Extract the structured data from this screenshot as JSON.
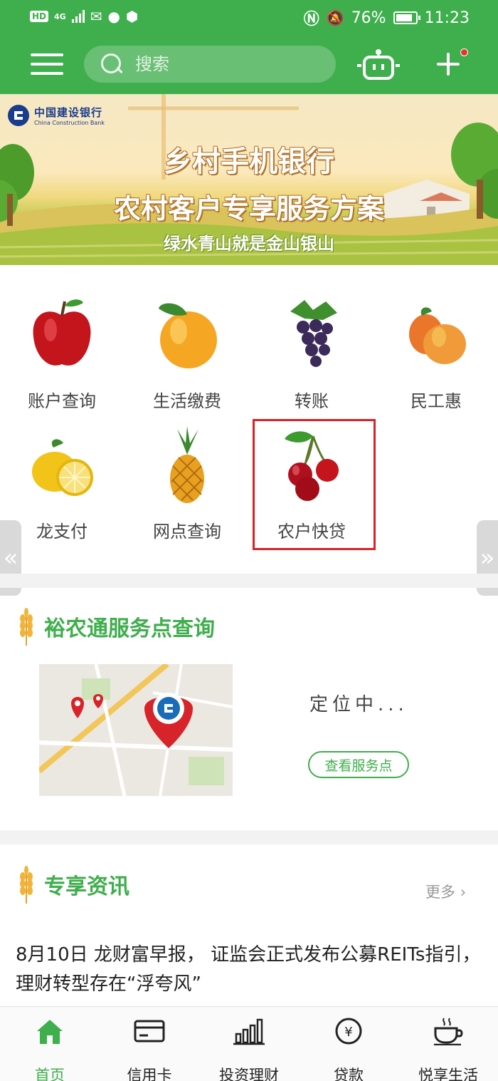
{
  "status_bar": {
    "hd": "HD",
    "network": "4G",
    "battery": "76%",
    "time": "11:23"
  },
  "header": {
    "search_placeholder": "搜索"
  },
  "banner": {
    "bank_name_cn": "中国建设银行",
    "bank_name_en": "China Construction Bank",
    "title": "乡村手机银行",
    "subtitle": "农村客户专享服务方案",
    "slogan": "绿水青山就是金山银山"
  },
  "grid": {
    "items": [
      {
        "label": "账户查询",
        "icon": "apple-icon"
      },
      {
        "label": "生活缴费",
        "icon": "apricot-icon"
      },
      {
        "label": "转账",
        "icon": "grape-icon"
      },
      {
        "label": "民工惠",
        "icon": "mango-icon"
      },
      {
        "label": "龙支付",
        "icon": "lemon-icon"
      },
      {
        "label": "网点查询",
        "icon": "pineapple-icon"
      },
      {
        "label": "农户快贷",
        "icon": "cherry-icon"
      }
    ]
  },
  "yunongtong": {
    "title": "裕农通服务点查询",
    "status": "定位中...",
    "button": "查看服务点"
  },
  "news": {
    "title": "专享资讯",
    "more": "更多",
    "headline": "8月10日 龙财富早报， 证监会正式发布公募REITs指引，理财转型存在“浮夸风”"
  },
  "tabbar": {
    "items": [
      {
        "label": "首页",
        "active": true
      },
      {
        "label": "信用卡",
        "active": false
      },
      {
        "label": "投资理财",
        "active": false
      },
      {
        "label": "贷款",
        "active": false
      },
      {
        "label": "悦享生活",
        "active": false
      }
    ]
  },
  "colors": {
    "brand_green": "#3fae4d",
    "highlight_red": "#d6242a"
  }
}
